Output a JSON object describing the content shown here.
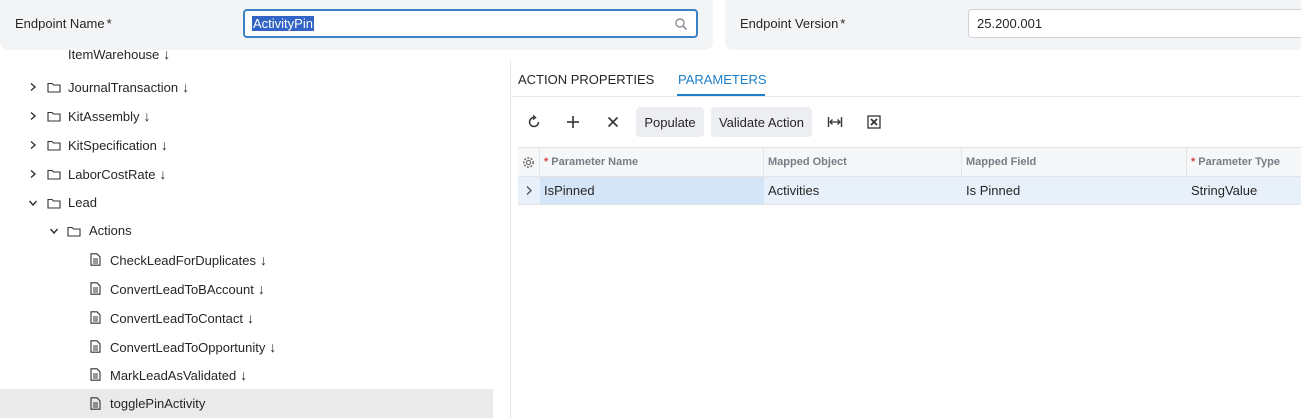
{
  "header": {
    "endpoint_name_label": "Endpoint Name",
    "endpoint_name_value": "ActivityPin",
    "endpoint_version_label": "Endpoint Version",
    "endpoint_version_value": "25.200.001",
    "required_mark": "*"
  },
  "tree": {
    "arrow": "↓",
    "partial_top": "ItemWarehouse",
    "items": [
      {
        "label": "JournalTransaction",
        "type": "folder",
        "state": "collapsed"
      },
      {
        "label": "KitAssembly",
        "type": "folder",
        "state": "collapsed"
      },
      {
        "label": "KitSpecification",
        "type": "folder",
        "state": "collapsed"
      },
      {
        "label": "LaborCostRate",
        "type": "folder",
        "state": "collapsed"
      },
      {
        "label": "Lead",
        "type": "folder",
        "state": "expanded"
      },
      {
        "label": "Actions",
        "type": "folder",
        "state": "expanded"
      },
      {
        "label": "CheckLeadForDuplicates",
        "type": "action"
      },
      {
        "label": "ConvertLeadToBAccount",
        "type": "action"
      },
      {
        "label": "ConvertLeadToContact",
        "type": "action"
      },
      {
        "label": "ConvertLeadToOpportunity",
        "type": "action"
      },
      {
        "label": "MarkLeadAsValidated",
        "type": "action"
      },
      {
        "label": "togglePinActivity",
        "type": "action",
        "selected": true
      }
    ]
  },
  "tabs": {
    "action_properties": "ACTION PROPERTIES",
    "parameters": "PARAMETERS",
    "active": "PARAMETERS"
  },
  "toolbar": {
    "populate": "Populate",
    "validate_action": "Validate Action",
    "icons": [
      "refresh-icon",
      "add-icon",
      "delete-icon",
      "fit-width-icon",
      "export-excel-icon"
    ]
  },
  "grid": {
    "columns": [
      {
        "label": "Parameter Name",
        "required": true
      },
      {
        "label": "Mapped Object",
        "required": false
      },
      {
        "label": "Mapped Field",
        "required": false
      },
      {
        "label": "Parameter Type",
        "required": true
      }
    ],
    "rows": [
      [
        "IsPinned",
        "Activities",
        "Is Pinned",
        "StringValue"
      ]
    ]
  },
  "colors": {
    "accent": "#1f7fc7",
    "selection": "#3264c8",
    "required": "#d24545"
  }
}
